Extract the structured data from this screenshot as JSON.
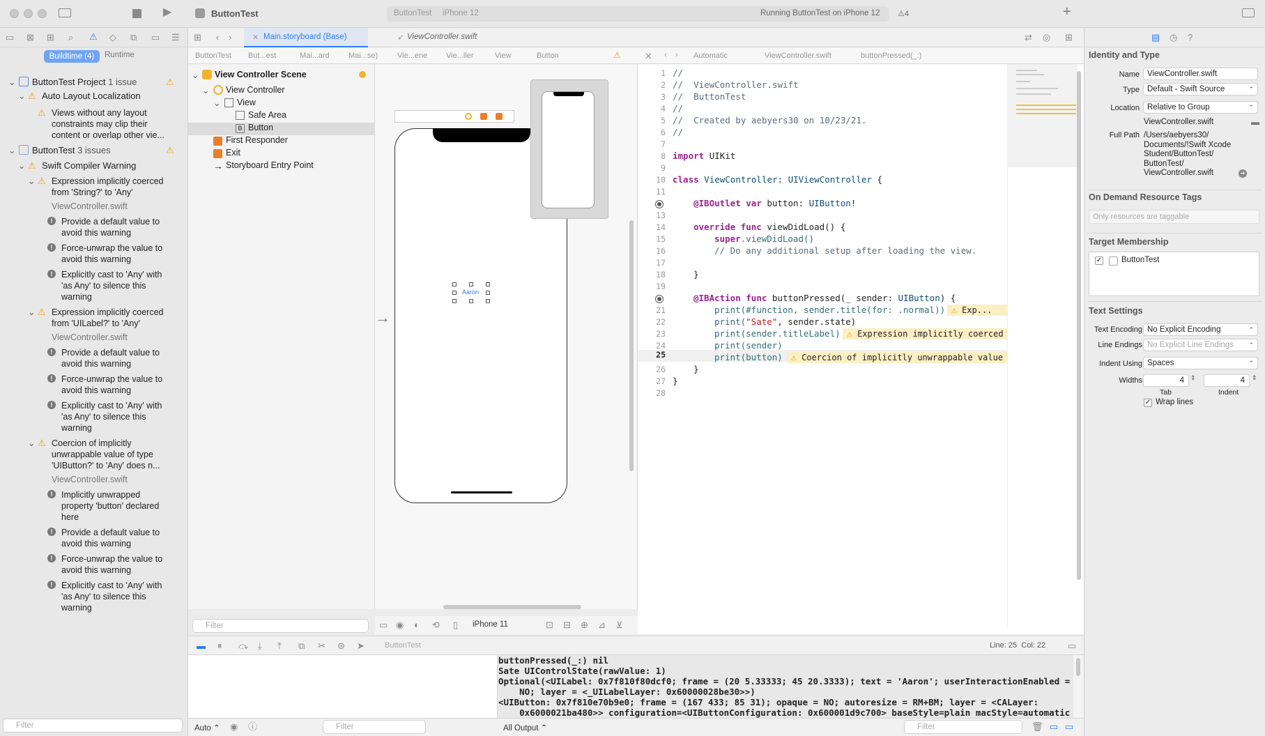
{
  "toolbar": {
    "app_title": "ButtonTest",
    "scheme": "ButtonTest",
    "device": "iPhone 12",
    "status": "Running ButtonTest on iPhone 12",
    "warning_count": "4",
    "plus": "+"
  },
  "tabs": [
    {
      "label": "Main.storyboard (Base)"
    },
    {
      "label": "ViewController.swift"
    }
  ],
  "navigator": {
    "segment_buildtime": "Buildtime (4)",
    "segment_runtime": "Runtime",
    "filter_placeholder": "Filter",
    "project": {
      "name": "ButtonTest Project",
      "count": "1 issue"
    },
    "auto_layout": "Auto Layout Localization",
    "auto_layout_msg": [
      "Views without any layout",
      "constraints may clip their",
      "content or overlap other vie..."
    ],
    "target": {
      "name": "ButtonTest",
      "count": "3 issues"
    },
    "compiler": "Swift Compiler Warning",
    "issues": [
      {
        "title": [
          "Expression implicitly coerced",
          "from 'String?' to 'Any'"
        ],
        "file": "ViewController.swift",
        "notes": [
          [
            "Provide a default value to",
            "avoid this warning"
          ],
          [
            "Force-unwrap the value to",
            "avoid this warning"
          ],
          [
            "Explicitly cast to 'Any' with",
            "'as Any' to silence this",
            "warning"
          ]
        ]
      },
      {
        "title": [
          "Expression implicitly coerced",
          "from 'UILabel?' to 'Any'"
        ],
        "file": "ViewController.swift",
        "notes": [
          [
            "Provide a default value to",
            "avoid this warning"
          ],
          [
            "Force-unwrap the value to",
            "avoid this warning"
          ],
          [
            "Explicitly cast to 'Any' with",
            "'as Any' to silence this",
            "warning"
          ]
        ]
      },
      {
        "title": [
          "Coercion of implicitly",
          "unwrappable value of type",
          "'UIButton?' to 'Any' does n..."
        ],
        "file": "ViewController.swift",
        "notes": [
          [
            "Implicitly unwrapped",
            "property 'button' declared",
            "here"
          ],
          [
            "Provide a default value to",
            "avoid this warning"
          ],
          [
            "Force-unwrap the value to",
            "avoid this warning"
          ],
          [
            "Explicitly cast to 'Any' with",
            "'as Any' to silence this",
            "warning"
          ]
        ]
      }
    ]
  },
  "ib_jumpbar": [
    "ButtonTest",
    "But...est",
    "Mai...ard",
    "Mai...se)",
    "Vie...ene",
    "Vie...ller",
    "View",
    "Button"
  ],
  "code_jumpbar": [
    "Automatic",
    "ViewController.swift",
    "buttonPressed(_:)"
  ],
  "outline": {
    "scene": "View Controller Scene",
    "vc": "View Controller",
    "view": "View",
    "safe_area": "Safe Area",
    "button": "Button",
    "first_responder": "First Responder",
    "exit": "Exit",
    "entry": "Storyboard Entry Point",
    "filter_placeholder": "Filter"
  },
  "canvas": {
    "button_text": "Aaron",
    "device": "iPhone 11"
  },
  "code": {
    "lines": [
      "1",
      "2",
      "3",
      "4",
      "5",
      "6",
      "7",
      "8",
      "9",
      "10",
      "11",
      "12",
      "13",
      "14",
      "15",
      "16",
      "17",
      "18",
      "19",
      "20",
      "21",
      "22",
      "23",
      "24",
      "25",
      "26",
      "27",
      "28"
    ],
    "comment1": "//",
    "filename": "//  ViewController.swift",
    "project": "//  ButtonTest",
    "comment4": "//",
    "created": "//  Created by aebyers30 on 10/23/21.",
    "comment6": "//",
    "import_kw": "import",
    "import_mod": "UIKit",
    "class_kw": "class",
    "class_name": "ViewController",
    "class_sep": ": ",
    "class_super": "UIViewController",
    "class_brace": " {",
    "outlet_attr": "@IBOutlet",
    "outlet_var": "var",
    "outlet_rest": " button: ",
    "outlet_type": "UIButton",
    "outlet_bang": "!",
    "override_kw": "override func",
    "override_name": " viewDidLoad() {",
    "super_kw": "super",
    "super_rest": ".viewDidLoad()",
    "setup_comment": "// Do any additional setup after loading the view.",
    "close_brace": "}",
    "action_attr": "@IBAction",
    "action_func": "func",
    "action_rest": " buttonPressed(_ sender: ",
    "action_type": "UIButton",
    "action_end": ") {",
    "l21": "print(#function, sender.title(for: .normal))",
    "l22_a": "print(",
    "l22_str": "\"Sate\"",
    "l22_b": ", sender.state)",
    "l23": "print(sender.titleLabel)",
    "l24": "print(sender)",
    "l25": "print(button)",
    "l26": "}",
    "l27": "}",
    "warn21": "Exp...",
    "warn23": "Expression implicitly coerced f...",
    "warn25": "Coercion of implicitly unwrappable value of ty..."
  },
  "status": {
    "cursor": "Line: 25  Col: 22",
    "process": "ButtonTest"
  },
  "console": {
    "lines": [
      "buttonPressed(_:) nil",
      "Sate UIControlState(rawValue: 1)",
      "Optional(<UILabel: 0x7f810f80dcf0; frame = (20 5.33333; 45 20.3333); text = 'Aaron'; userInteractionEnabled =",
      "    NO; layer = <_UILabelLayer: 0x60000028be30>>)",
      "<UIButton: 0x7f810e70b9e0; frame = (167 433; 85 31); opaque = NO; autoresize = RM+BM; layer = <CALayer:",
      "    0x6000021ba480>> configuration=<UIButtonConfiguration: 0x600001d9c700> baseStyle=plain macStyle=automatic"
    ],
    "output_menu": "All Output",
    "auto_menu": "Auto",
    "filter_placeholder": "Filter"
  },
  "inspector": {
    "identity_header": "Identity and Type",
    "name_label": "Name",
    "name_value": "ViewController.swift",
    "type_label": "Type",
    "type_value": "Default - Swift Source",
    "location_label": "Location",
    "location_value": "Relative to Group",
    "location_file": "ViewController.swift",
    "fullpath_label": "Full Path",
    "fullpath_lines": [
      "/Users/aebyers30/",
      "Documents/!Swift Xcode",
      "Student/ButtonTest/",
      "ButtonTest/",
      "ViewController.swift"
    ],
    "odr_header": "On Demand Resource Tags",
    "odr_placeholder": "Only resources are taggable",
    "target_header": "Target Membership",
    "target_item": "ButtonTest",
    "text_header": "Text Settings",
    "encoding_label": "Text Encoding",
    "encoding_value": "No Explicit Encoding",
    "endings_label": "Line Endings",
    "endings_value": "No Explicit Line Endings",
    "indent_label": "Indent Using",
    "indent_value": "Spaces",
    "widths_label": "Widths",
    "tab_value": "4",
    "indent_value2": "4",
    "tab_caption": "Tab",
    "indent_caption": "Indent",
    "wrap_label": "Wrap lines"
  },
  "colors": {
    "accent": "#2f7cf6",
    "warning": "#e8a500",
    "warn_bg": "#fcefc4"
  }
}
